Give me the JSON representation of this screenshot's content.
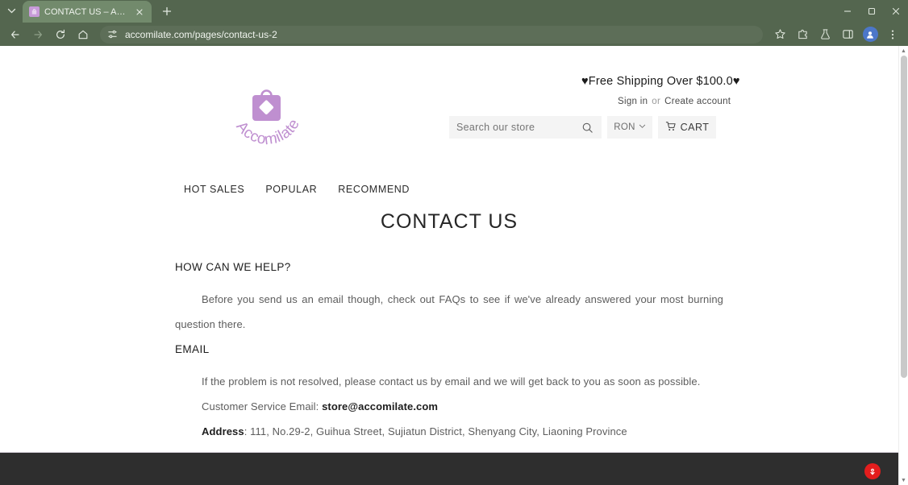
{
  "browser": {
    "tab": {
      "title": "CONTACT US – Accomilate",
      "favicon": "shopping-bag-icon"
    },
    "new_tab_label": "+",
    "window_controls": {
      "minimize": "–",
      "maximize": "□",
      "close": "×"
    },
    "toolbar": {
      "back": "back-icon",
      "forward": "forward-icon",
      "reload": "reload-icon",
      "home": "home-icon",
      "site_settings": "tune-icon",
      "url": "accomilate.com/pages/contact-us-2",
      "bookmark": "star-icon",
      "extensions": "puzzle-icon",
      "labs": "flask-icon",
      "side_panel": "side-panel-icon",
      "profile": "profile-avatar",
      "menu": "three-dot-menu"
    }
  },
  "store": {
    "logo_text": "Accomilate",
    "promo": "♥Free Shipping Over $100.0♥",
    "account": {
      "sign_in": "Sign in",
      "or": "or",
      "create": "Create account"
    },
    "search": {
      "placeholder": "Search our store",
      "value": ""
    },
    "currency": "RON",
    "cart_label": "CART",
    "nav": [
      {
        "label": "HOT SALES"
      },
      {
        "label": "POPULAR"
      },
      {
        "label": "RECOMMEND"
      }
    ]
  },
  "content": {
    "title": "CONTACT US",
    "section_help": "HOW CAN WE HELP?",
    "help_paragraph": "Before you send us an email though, check out FAQs to see if we've already answered your most burning question there.",
    "section_email": "EMAIL",
    "email_paragraph": "If the problem is not resolved, please contact us by email and we will get back to you as soon as possible.",
    "service_email_label": "Customer Service Email: ",
    "service_email": "store@accomilate.com",
    "address_label": "Address",
    "address_value": ": 111, No.29-2, Guihua Street, Sujiatun District, Shenyang City, Liaoning Province"
  },
  "widgets": {
    "chat_badge": "chat-bubble-icon"
  },
  "colors": {
    "chrome": "#54664f",
    "tab_active": "#728a6c",
    "brand_purple": "#b98bc9",
    "footer": "#2e2e2e",
    "badge_red": "#e31d1d"
  }
}
